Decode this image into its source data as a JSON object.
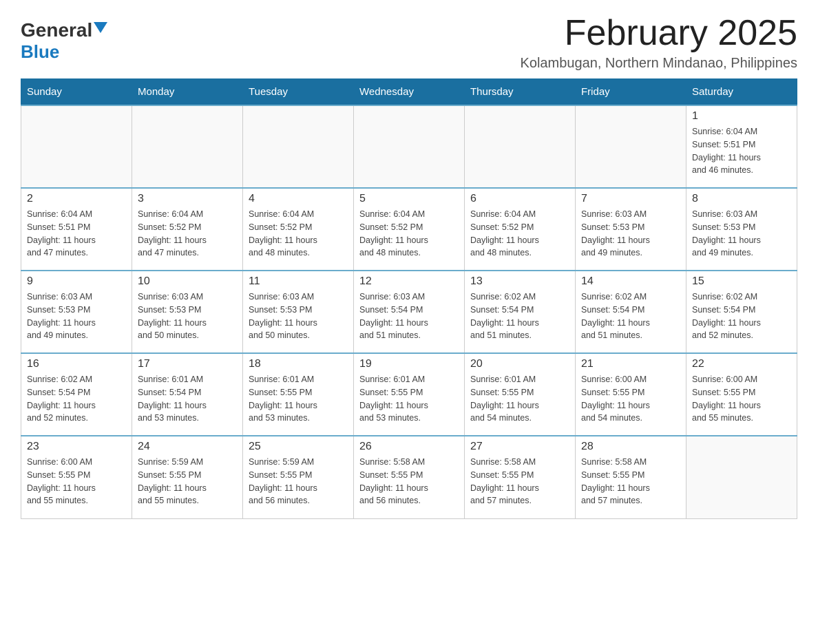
{
  "header": {
    "logo_general": "General",
    "logo_blue": "Blue",
    "month_title": "February 2025",
    "location": "Kolambugan, Northern Mindanao, Philippines"
  },
  "days_of_week": [
    "Sunday",
    "Monday",
    "Tuesday",
    "Wednesday",
    "Thursday",
    "Friday",
    "Saturday"
  ],
  "weeks": [
    [
      {
        "day": "",
        "info": ""
      },
      {
        "day": "",
        "info": ""
      },
      {
        "day": "",
        "info": ""
      },
      {
        "day": "",
        "info": ""
      },
      {
        "day": "",
        "info": ""
      },
      {
        "day": "",
        "info": ""
      },
      {
        "day": "1",
        "info": "Sunrise: 6:04 AM\nSunset: 5:51 PM\nDaylight: 11 hours\nand 46 minutes."
      }
    ],
    [
      {
        "day": "2",
        "info": "Sunrise: 6:04 AM\nSunset: 5:51 PM\nDaylight: 11 hours\nand 47 minutes."
      },
      {
        "day": "3",
        "info": "Sunrise: 6:04 AM\nSunset: 5:52 PM\nDaylight: 11 hours\nand 47 minutes."
      },
      {
        "day": "4",
        "info": "Sunrise: 6:04 AM\nSunset: 5:52 PM\nDaylight: 11 hours\nand 48 minutes."
      },
      {
        "day": "5",
        "info": "Sunrise: 6:04 AM\nSunset: 5:52 PM\nDaylight: 11 hours\nand 48 minutes."
      },
      {
        "day": "6",
        "info": "Sunrise: 6:04 AM\nSunset: 5:52 PM\nDaylight: 11 hours\nand 48 minutes."
      },
      {
        "day": "7",
        "info": "Sunrise: 6:03 AM\nSunset: 5:53 PM\nDaylight: 11 hours\nand 49 minutes."
      },
      {
        "day": "8",
        "info": "Sunrise: 6:03 AM\nSunset: 5:53 PM\nDaylight: 11 hours\nand 49 minutes."
      }
    ],
    [
      {
        "day": "9",
        "info": "Sunrise: 6:03 AM\nSunset: 5:53 PM\nDaylight: 11 hours\nand 49 minutes."
      },
      {
        "day": "10",
        "info": "Sunrise: 6:03 AM\nSunset: 5:53 PM\nDaylight: 11 hours\nand 50 minutes."
      },
      {
        "day": "11",
        "info": "Sunrise: 6:03 AM\nSunset: 5:53 PM\nDaylight: 11 hours\nand 50 minutes."
      },
      {
        "day": "12",
        "info": "Sunrise: 6:03 AM\nSunset: 5:54 PM\nDaylight: 11 hours\nand 51 minutes."
      },
      {
        "day": "13",
        "info": "Sunrise: 6:02 AM\nSunset: 5:54 PM\nDaylight: 11 hours\nand 51 minutes."
      },
      {
        "day": "14",
        "info": "Sunrise: 6:02 AM\nSunset: 5:54 PM\nDaylight: 11 hours\nand 51 minutes."
      },
      {
        "day": "15",
        "info": "Sunrise: 6:02 AM\nSunset: 5:54 PM\nDaylight: 11 hours\nand 52 minutes."
      }
    ],
    [
      {
        "day": "16",
        "info": "Sunrise: 6:02 AM\nSunset: 5:54 PM\nDaylight: 11 hours\nand 52 minutes."
      },
      {
        "day": "17",
        "info": "Sunrise: 6:01 AM\nSunset: 5:54 PM\nDaylight: 11 hours\nand 53 minutes."
      },
      {
        "day": "18",
        "info": "Sunrise: 6:01 AM\nSunset: 5:55 PM\nDaylight: 11 hours\nand 53 minutes."
      },
      {
        "day": "19",
        "info": "Sunrise: 6:01 AM\nSunset: 5:55 PM\nDaylight: 11 hours\nand 53 minutes."
      },
      {
        "day": "20",
        "info": "Sunrise: 6:01 AM\nSunset: 5:55 PM\nDaylight: 11 hours\nand 54 minutes."
      },
      {
        "day": "21",
        "info": "Sunrise: 6:00 AM\nSunset: 5:55 PM\nDaylight: 11 hours\nand 54 minutes."
      },
      {
        "day": "22",
        "info": "Sunrise: 6:00 AM\nSunset: 5:55 PM\nDaylight: 11 hours\nand 55 minutes."
      }
    ],
    [
      {
        "day": "23",
        "info": "Sunrise: 6:00 AM\nSunset: 5:55 PM\nDaylight: 11 hours\nand 55 minutes."
      },
      {
        "day": "24",
        "info": "Sunrise: 5:59 AM\nSunset: 5:55 PM\nDaylight: 11 hours\nand 55 minutes."
      },
      {
        "day": "25",
        "info": "Sunrise: 5:59 AM\nSunset: 5:55 PM\nDaylight: 11 hours\nand 56 minutes."
      },
      {
        "day": "26",
        "info": "Sunrise: 5:58 AM\nSunset: 5:55 PM\nDaylight: 11 hours\nand 56 minutes."
      },
      {
        "day": "27",
        "info": "Sunrise: 5:58 AM\nSunset: 5:55 PM\nDaylight: 11 hours\nand 57 minutes."
      },
      {
        "day": "28",
        "info": "Sunrise: 5:58 AM\nSunset: 5:55 PM\nDaylight: 11 hours\nand 57 minutes."
      },
      {
        "day": "",
        "info": ""
      }
    ]
  ]
}
